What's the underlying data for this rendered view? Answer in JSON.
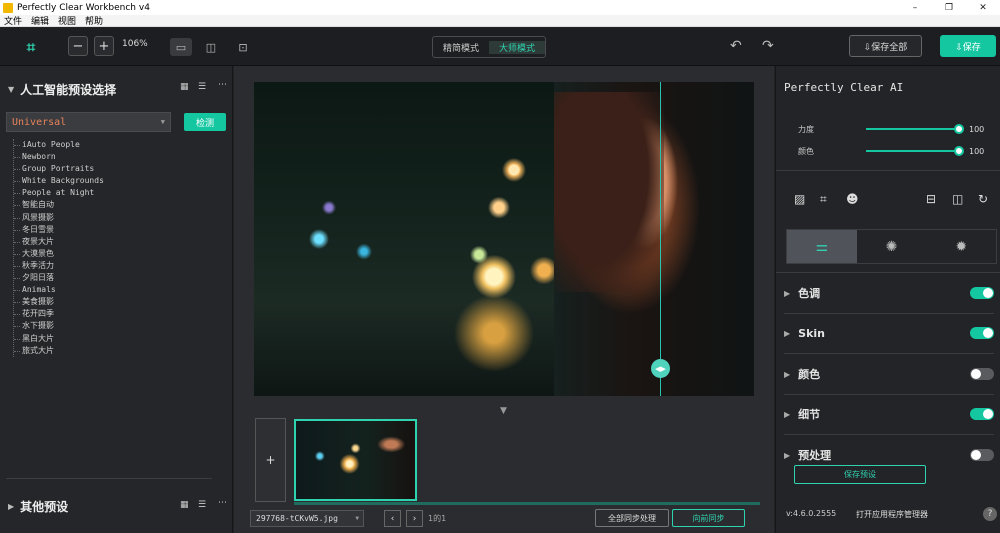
{
  "window": {
    "title": "Perfectly Clear Workbench v4",
    "controls": [
      "–",
      "❐",
      "✕"
    ]
  },
  "menu": [
    "文件",
    "编辑",
    "视图",
    "帮助"
  ],
  "toolbar": {
    "zoom": "106%",
    "zoom_out": "−",
    "zoom_in": "+",
    "modes": {
      "simple": "精简模式",
      "master": "大师模式"
    },
    "save_all": "⇩保存全部",
    "save": "⇩保存"
  },
  "left": {
    "ai_title": "人工智能预设选择",
    "dropdown_value": "Universal",
    "detect": "检测",
    "presets": [
      "iAuto People",
      "Newborn",
      "Group Portraits",
      "White Backgrounds",
      "People at Night",
      "智能自动",
      "风景摄影",
      "冬日雪景",
      "夜景大片",
      "大漠景色",
      "秋季活力",
      "夕阳日落",
      "Animals",
      "美食摄影",
      "花开四季",
      "水下摄影",
      "黑白大片",
      "旅式大片"
    ],
    "other_title": "其他预设"
  },
  "center": {
    "add": "+",
    "file_name": "297768-tCKvW5.jpg",
    "prev": "‹",
    "next": "›",
    "page_info": "1的1",
    "sync_all": "全部同步处理",
    "sync_forward": "向前同步"
  },
  "right": {
    "title": "Perfectly Clear AI",
    "strength_label": "力度",
    "strength_value": "100",
    "color_label": "颜色",
    "color_value": "100",
    "sections": [
      {
        "label": "色调",
        "on": true
      },
      {
        "label": "Skin",
        "on": true
      },
      {
        "label": "颜色",
        "on": false
      },
      {
        "label": "细节",
        "on": true
      },
      {
        "label": "预处理",
        "on": false
      }
    ],
    "save_preset": "保存预设",
    "version": "v:4.6.0.2555",
    "open_manager": "打开应用程序管理器",
    "help": "?"
  },
  "colors": {
    "accent": "#14c7a1",
    "preset_text": "#e8845a",
    "bg": "#222326"
  }
}
